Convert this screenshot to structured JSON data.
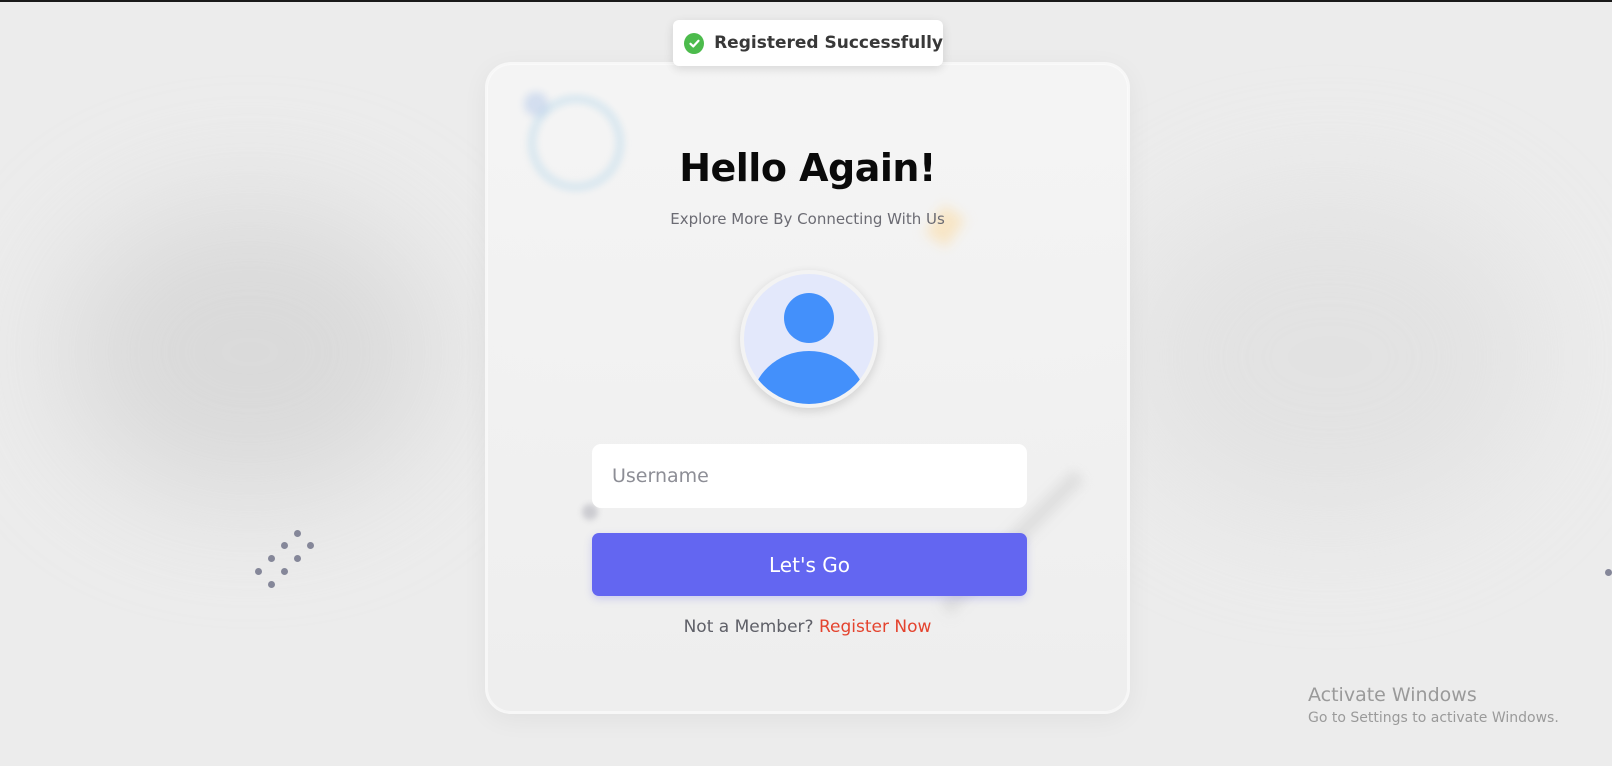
{
  "toast": {
    "message": "Registered Successfully",
    "icon": "check-circle-icon",
    "color": "#4cbb4c"
  },
  "login": {
    "title": "Hello Again!",
    "subtitle": "Explore More By Connecting With Us",
    "avatar_icon": "user-avatar-icon",
    "username_placeholder": "Username",
    "username_value": "",
    "submit_label": "Let's Go",
    "member_prompt": "Not a Member?",
    "register_link": "Register Now"
  },
  "colors": {
    "primary": "#6366f1",
    "link": "#e4432e",
    "avatar_fill": "#4390fb",
    "avatar_bg": "#e3e8fb"
  },
  "watermark": {
    "title": "Activate Windows",
    "subtitle": "Go to Settings to activate Windows."
  }
}
